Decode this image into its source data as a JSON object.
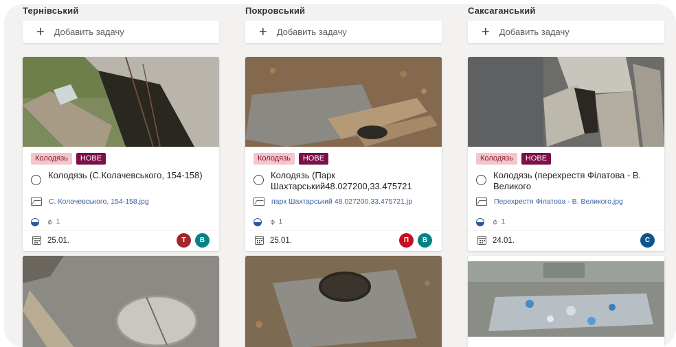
{
  "add_task_label": "Добавить задачу",
  "columns": [
    {
      "title": "Тернівський",
      "card": {
        "category_tag": "Колодязь",
        "status_tag": "НОВЕ",
        "title": "Колодязь (С.Колачевського, 154-158)",
        "attachment": "С. Колачевського, 154-158.jpg",
        "attachment_count": "1",
        "date": "25.01.",
        "assignees": [
          {
            "initial": "Т",
            "color": "#a4262c"
          },
          {
            "initial": "В",
            "color": "#038387"
          }
        ]
      }
    },
    {
      "title": "Покровський",
      "card": {
        "category_tag": "Колодязь",
        "status_tag": "НОВЕ",
        "title": "Колодязь (Парк Шахтарський48.027200,33.475721",
        "attachment": "парк Шахтарський 48.027200,33.475721.jp",
        "attachment_count": "1",
        "date": "25.01.",
        "assignees": [
          {
            "initial": "П",
            "color": "#c50f1f"
          },
          {
            "initial": "В",
            "color": "#038387"
          }
        ]
      }
    },
    {
      "title": "Саксаганський",
      "card": {
        "category_tag": "Колодязь",
        "status_tag": "НОВЕ",
        "title": "Колодязь (перехрестя Філатова - В. Великого",
        "attachment": "Перехрестя Філатова - В. Великого.jpg",
        "attachment_count": "1",
        "date": "24.01.",
        "assignees": [
          {
            "initial": "С",
            "color": "#0f548c"
          }
        ]
      }
    }
  ],
  "colors": {
    "board_bg": "#f3f2f1",
    "tag_category_bg": "#f2c6cc",
    "tag_new_bg": "#7c1046",
    "link": "#3a5fa0"
  }
}
